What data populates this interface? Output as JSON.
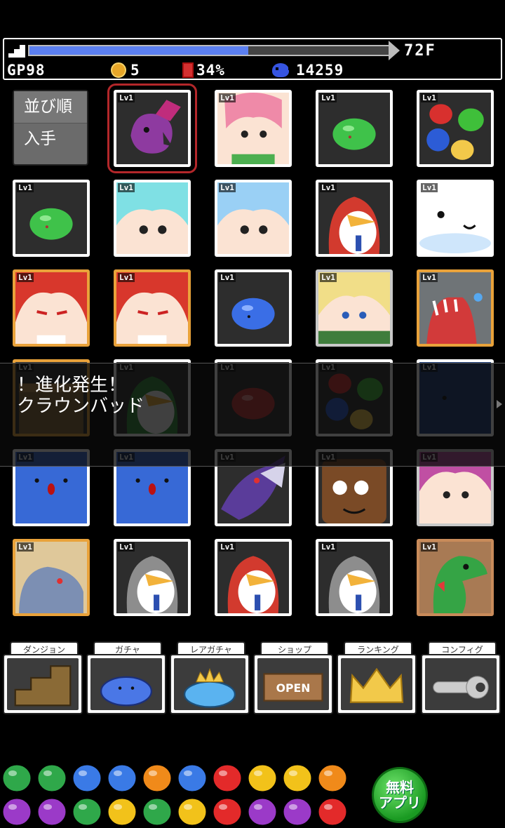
{
  "status": {
    "floor_progress": 0.61,
    "floor_label": "72F",
    "gp": "GP98",
    "coins": "5",
    "food": "34%",
    "mana": "14259"
  },
  "sort_menu": {
    "order_label": "並び順",
    "obtained_label": "入手"
  },
  "level_label": "Lv1",
  "monsters": [
    {
      "name": "purple-bat-imp",
      "frame": "white",
      "selected": true
    },
    {
      "name": "pink-haired-girl",
      "frame": "white"
    },
    {
      "name": "green-slime",
      "frame": "white"
    },
    {
      "name": "color-slime-cluster",
      "frame": "white"
    },
    {
      "name": "green-slime",
      "frame": "white"
    },
    {
      "name": "cyan-haired-girl",
      "frame": "white"
    },
    {
      "name": "blue-haired-girl",
      "frame": "white"
    },
    {
      "name": "red-penguin",
      "frame": "white"
    },
    {
      "name": "white-blob",
      "frame": "white"
    },
    {
      "name": "red-haired-vampire",
      "frame": "gold"
    },
    {
      "name": "red-haired-vampire",
      "frame": "gold"
    },
    {
      "name": "blue-slime",
      "frame": "white"
    },
    {
      "name": "blonde-elf",
      "frame": "silver"
    },
    {
      "name": "grey-dragon",
      "frame": "gold"
    },
    {
      "name": "brown-box",
      "frame": "gold"
    },
    {
      "name": "green-penguin",
      "frame": "white"
    },
    {
      "name": "red-slime",
      "frame": "white"
    },
    {
      "name": "color-slime-cluster",
      "frame": "white"
    },
    {
      "name": "navy-blob",
      "frame": "white"
    },
    {
      "name": "blue-blob",
      "frame": "white"
    },
    {
      "name": "blue-blob",
      "frame": "white"
    },
    {
      "name": "purple-dragon",
      "frame": "white"
    },
    {
      "name": "brown-blob",
      "frame": "white"
    },
    {
      "name": "purple-haired-girl",
      "frame": "silver"
    },
    {
      "name": "blue-dragon",
      "frame": "gold"
    },
    {
      "name": "grey-penguin",
      "frame": "white"
    },
    {
      "name": "red-penguin",
      "frame": "white"
    },
    {
      "name": "grey-penguin",
      "frame": "white"
    },
    {
      "name": "green-dino",
      "frame": "bronze"
    }
  ],
  "evolution": {
    "title": "！進化発生！",
    "monster_name": "クラウンバッド"
  },
  "menu": [
    {
      "label": "ダンジョン",
      "icon": "dungeon-stairs-icon"
    },
    {
      "label": "ガチャ",
      "icon": "blue-slime-icon"
    },
    {
      "label": "レアガチャ",
      "icon": "crowned-slime-icon"
    },
    {
      "label": "ショップ",
      "icon": "open-sign-icon"
    },
    {
      "label": "ランキング",
      "icon": "crown-icon"
    },
    {
      "label": "コンフィグ",
      "icon": "wrench-icon"
    }
  ],
  "ad": {
    "badge_line1": "無料",
    "badge_line2": "アプリ"
  },
  "colors": {
    "progress": "#5b7ff0",
    "gold_frame": "#e9a23a",
    "selected": "#b3272a",
    "ad_badge": "#1a9a22"
  }
}
